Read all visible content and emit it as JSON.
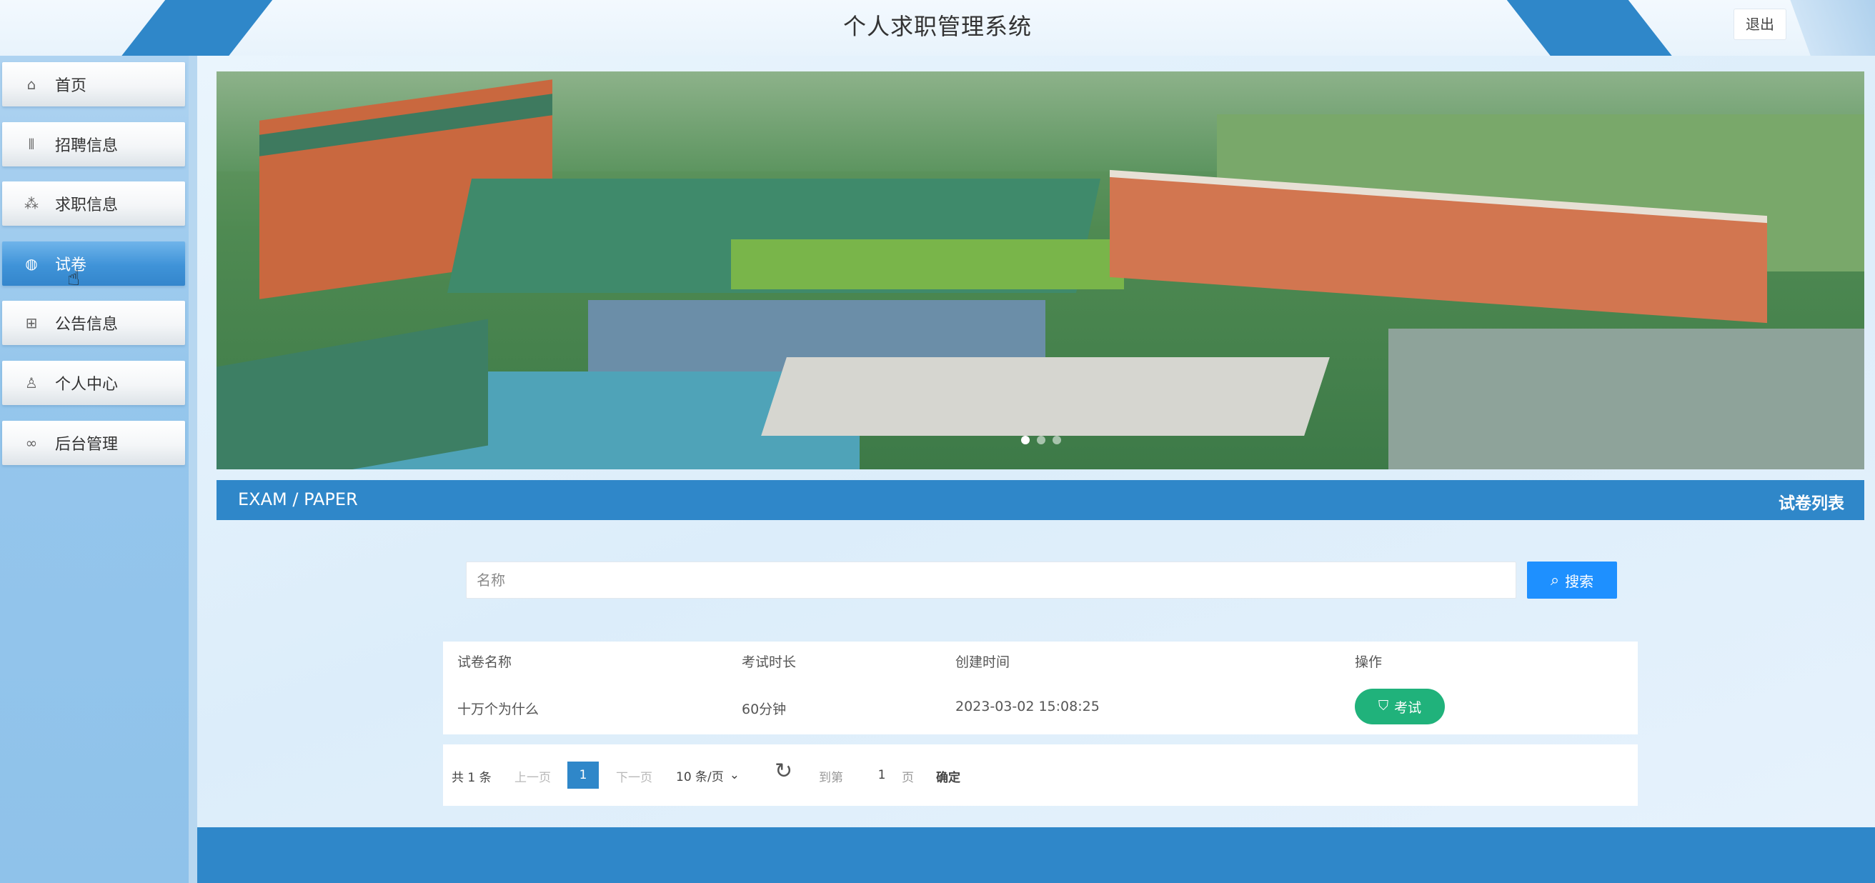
{
  "header": {
    "title": "个人求职管理系统",
    "logout_label": "退出"
  },
  "sidebar": {
    "items": [
      {
        "label": "首页",
        "icon": "home-icon"
      },
      {
        "label": "招聘信息",
        "icon": "recruit-icon"
      },
      {
        "label": "求职信息",
        "icon": "job-seek-icon"
      },
      {
        "label": "试卷",
        "icon": "paper-icon",
        "active": true
      },
      {
        "label": "公告信息",
        "icon": "notice-icon"
      },
      {
        "label": "个人中心",
        "icon": "user-icon"
      },
      {
        "label": "后台管理",
        "icon": "link-icon"
      }
    ]
  },
  "banner": {
    "slides": 3,
    "active_slide": 1
  },
  "section": {
    "en_title": "EXAM / PAPER",
    "cn_title": "试卷列表"
  },
  "search": {
    "placeholder": "名称",
    "value": "",
    "button_label": "搜索"
  },
  "table": {
    "headers": [
      "试卷名称",
      "考试时长",
      "创建时间",
      "操作"
    ],
    "rows": [
      {
        "name": "十万个为什么",
        "duration": "60分钟",
        "created": "2023-03-02 15:08:25",
        "action_label": "考试"
      }
    ]
  },
  "pagination": {
    "total": "共 1 条",
    "prev": "上一页",
    "current_page": "1",
    "next": "下一页",
    "page_size": "10 条/页",
    "goto_label": "到第",
    "goto_value": "1",
    "page_unit": "页",
    "confirm": "确定"
  },
  "colors": {
    "primary": "#2f87c9",
    "search_button": "#1e90ff",
    "exam_button": "#20b27b"
  }
}
